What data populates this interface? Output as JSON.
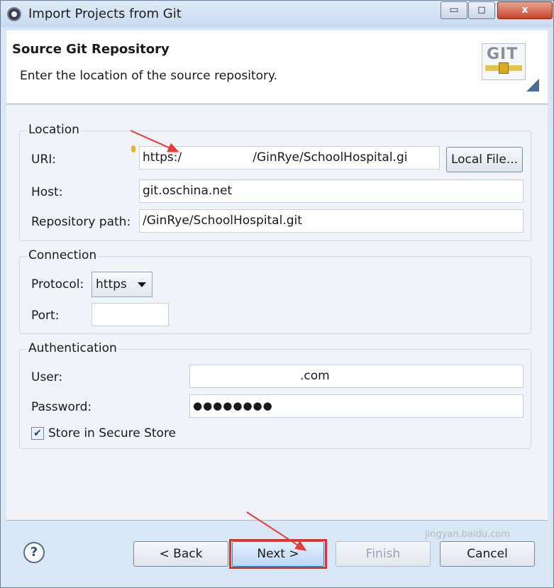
{
  "window": {
    "title": "Import Projects from Git",
    "controls": {
      "minimize": "▭",
      "maximize": "◻",
      "close": "x"
    }
  },
  "header": {
    "title": "Source Git Repository",
    "subtitle": "Enter the location of the source repository.",
    "logo_text": "GIT"
  },
  "location": {
    "legend": "Location",
    "uri_label": "URI:",
    "uri_value_prefix": "https:/",
    "uri_value_suffix": "/GinRye/SchoolHospital.gi",
    "local_file_button": "Local File...",
    "host_label": "Host:",
    "host_value": "git.oschina.net",
    "repo_path_label": "Repository path:",
    "repo_path_value": "/GinRye/SchoolHospital.git"
  },
  "connection": {
    "legend": "Connection",
    "protocol_label": "Protocol:",
    "protocol_value": "https",
    "port_label": "Port:",
    "port_value": ""
  },
  "authentication": {
    "legend": "Authentication",
    "user_label": "User:",
    "user_value_suffix": ".com",
    "password_label": "Password:",
    "password_value": "●●●●●●●●",
    "store_checkbox_label": "Store in Secure Store",
    "store_checked": true
  },
  "footer": {
    "help_symbol": "?",
    "back_button": "< Back",
    "next_button": "Next >",
    "finish_button": "Finish",
    "cancel_button": "Cancel"
  },
  "watermark": "jingyan.baidu.com",
  "colors": {
    "annotation_red": "#e03030",
    "accent_blue": "#3a7bd5"
  }
}
